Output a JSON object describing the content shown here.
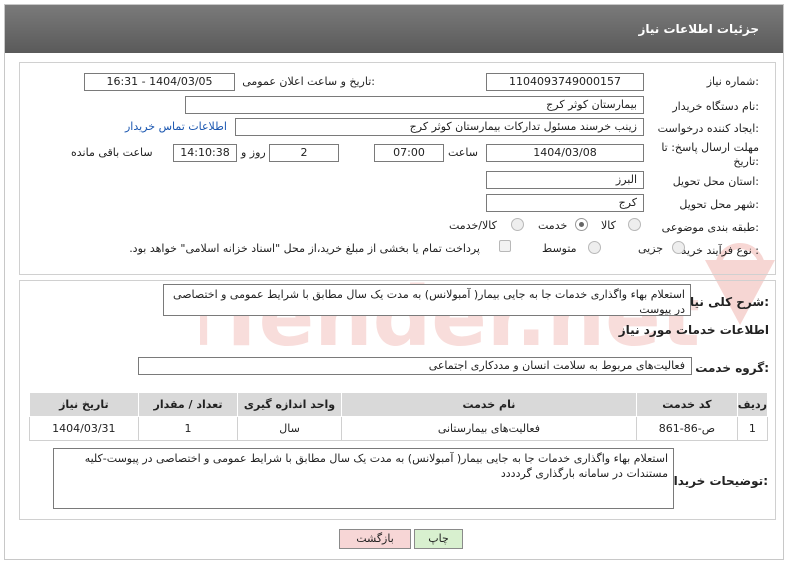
{
  "header": {
    "title": "جزئیات اطلاعات نیاز"
  },
  "form": {
    "need_number": {
      "label": "شماره نیاز:",
      "value": "1104093749000157"
    },
    "announce": {
      "label": "تاریخ و ساعت اعلان عمومی:",
      "value": "1404/03/05 - 16:31"
    },
    "buyer_org": {
      "label": "نام دستگاه خریدار:",
      "value": "بیمارستان کوثر کرج"
    },
    "creator": {
      "label": "ایجاد کننده درخواست:",
      "value": "زینب خرسند مسئول تدارکات بیمارستان کوثر کرج",
      "contact_link": "اطلاعات تماس خریدار"
    },
    "deadline": {
      "label_line1": "مهلت ارسال پاسخ: تا",
      "label_line2": "تاریخ:",
      "date": "1404/03/08",
      "time_label": "ساعت",
      "time": "07:00",
      "days": "2",
      "days_label": "روز و",
      "remaining": "14:10:38",
      "remaining_label": "ساعت باقی مانده"
    },
    "province": {
      "label": "استان محل تحویل:",
      "value": "البرز"
    },
    "city": {
      "label": "شهر محل تحویل:",
      "value": "کرج"
    },
    "category": {
      "label": "طبقه بندی موضوعی:",
      "options": [
        "کالا",
        "خدمت",
        "کالا/خدمت"
      ],
      "selected": "خدمت"
    },
    "process": {
      "label": "نوع فرآیند خرید :",
      "options": [
        "جزیی",
        "متوسط"
      ],
      "note": "پرداخت تمام یا بخشی از مبلغ خرید،از محل \"اسناد خزانه اسلامی\" خواهد بود."
    }
  },
  "description": {
    "label": "شرح کلی نیاز:",
    "value": "استعلام بهاء واگذاری خدمات جا به جایی بیمار( آمبولانس) به مدت یک سال مطابق با شرایط عمومی و اختصاصی در پیوست"
  },
  "services": {
    "title": "اطلاعات خدمات مورد نیاز",
    "group_label": "گروه خدمت:",
    "group_value": "فعالیت‌های مربوط به سلامت انسان و مددکاری اجتماعی",
    "columns": [
      "ردیف",
      "کد خدمت",
      "نام خدمت",
      "واحد اندازه گیری",
      "تعداد / مقدار",
      "تاریخ نیاز"
    ],
    "rows": [
      [
        "1",
        "ص-86-861",
        "فعالیت‌های بیمارستانی",
        "سال",
        "1",
        "1404/03/31"
      ]
    ]
  },
  "buyer_notes": {
    "label": "توضیحات خریدار:",
    "value": "استعلام بهاء واگذاری خدمات جا به جایی بیمار( آمبولانس) به مدت یک سال مطابق با شرایط عمومی و اختصاصی در پیوست-کلیه مستندات در سامانه بارگذاری گردددد"
  },
  "buttons": {
    "print": "چاپ",
    "back": "بازگشت"
  },
  "watermark": {
    "text": "AriaTender.net"
  },
  "colors": {
    "header_bg": "#6a6a6a",
    "link": "#1a56b0",
    "print_btn": "#d8f0cf",
    "back_btn": "#f7d6d6",
    "watermark": "#d9473b"
  }
}
